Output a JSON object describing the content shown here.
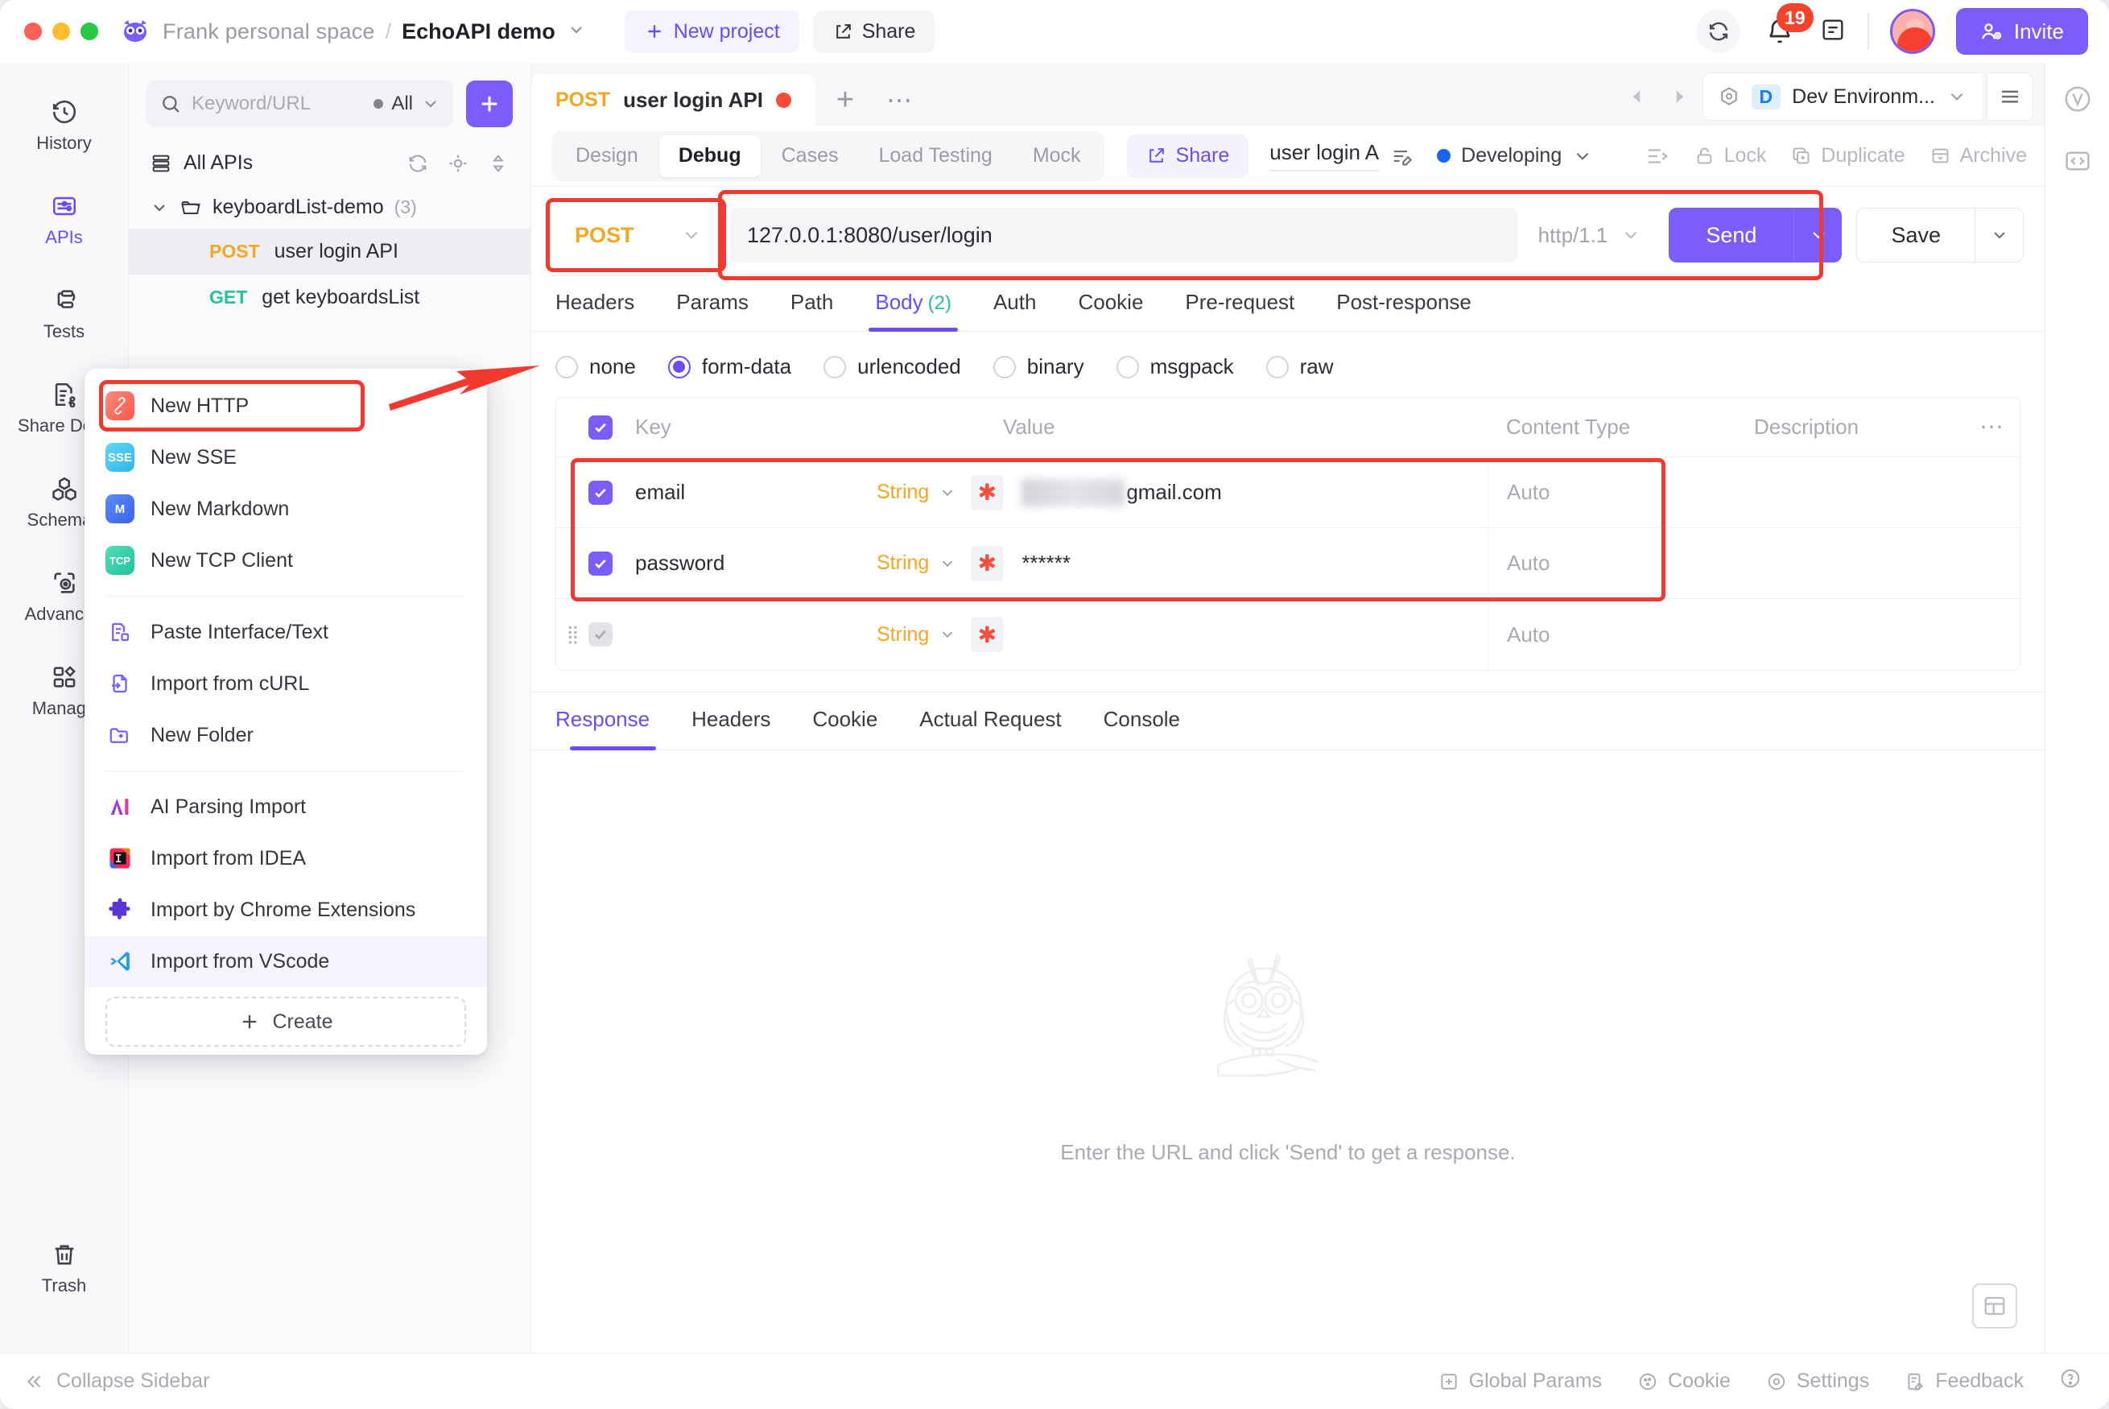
{
  "titlebar": {
    "workspace": "Frank personal space",
    "separator": "/",
    "project": "EchoAPI demo",
    "new_project": "New project",
    "share": "Share",
    "notification_count": "19",
    "invite": "Invite"
  },
  "rail": {
    "items": [
      {
        "label": "History",
        "icon": "history-icon",
        "active": false
      },
      {
        "label": "APIs",
        "icon": "apis-icon",
        "active": true
      },
      {
        "label": "Tests",
        "icon": "tests-icon",
        "active": false
      },
      {
        "label": "Share Docs",
        "icon": "share-docs-icon",
        "active": false
      },
      {
        "label": "Schemas",
        "icon": "schemas-icon",
        "active": false
      },
      {
        "label": "Advanced",
        "icon": "advanced-icon",
        "active": false
      },
      {
        "label": "Manage",
        "icon": "manage-icon",
        "active": false
      }
    ],
    "trash": "Trash"
  },
  "sidebar": {
    "search_placeholder": "Keyword/URL",
    "filter_label": "All",
    "all_apis": "All APIs",
    "folder": {
      "name": "keyboardList-demo",
      "count": "(3)"
    },
    "apis": [
      {
        "method": "POST",
        "name": "user login API",
        "selected": true
      },
      {
        "method": "GET",
        "name": "get keyboardsList",
        "selected": false
      }
    ]
  },
  "context_menu": {
    "group1": [
      {
        "label": "New HTTP",
        "icon": "http-icon",
        "highlighted": false
      },
      {
        "label": "New SSE",
        "icon": "sse-icon",
        "highlighted": false
      },
      {
        "label": "New Markdown",
        "icon": "markdown-icon",
        "highlighted": false
      },
      {
        "label": "New TCP Client",
        "icon": "tcp-icon",
        "highlighted": false
      }
    ],
    "group2": [
      {
        "label": "Paste Interface/Text",
        "icon": "paste-icon",
        "highlighted": false
      },
      {
        "label": "Import from cURL",
        "icon": "curl-import-icon",
        "highlighted": false
      },
      {
        "label": "New Folder",
        "icon": "new-folder-icon",
        "highlighted": false
      }
    ],
    "group3": [
      {
        "label": "AI Parsing Import",
        "icon": "ai-icon",
        "highlighted": false
      },
      {
        "label": "Import from IDEA",
        "icon": "idea-icon",
        "highlighted": false
      },
      {
        "label": "Import by Chrome Extensions",
        "icon": "chrome-extension-icon",
        "highlighted": false
      },
      {
        "label": "Import from VScode",
        "icon": "vscode-icon",
        "highlighted": true
      }
    ],
    "create": "Create"
  },
  "doc_tab": {
    "method": "POST",
    "title": "user login API",
    "env_badge": "D",
    "env_name": "Dev Environm..."
  },
  "subbar": {
    "segments": [
      {
        "label": "Design",
        "active": false
      },
      {
        "label": "Debug",
        "active": true
      },
      {
        "label": "Cases",
        "active": false
      },
      {
        "label": "Load Testing",
        "active": false
      },
      {
        "label": "Mock",
        "active": false
      }
    ],
    "share": "Share",
    "api_name": "user login A",
    "status": "Developing",
    "actions": [
      {
        "label": "Lock",
        "icon": "lock-icon"
      },
      {
        "label": "Duplicate",
        "icon": "duplicate-icon"
      },
      {
        "label": "Archive",
        "icon": "archive-icon"
      }
    ]
  },
  "request": {
    "method": "POST",
    "url": "127.0.0.1:8080/user/login",
    "protocol": "http/1.1",
    "send": "Send",
    "save": "Save",
    "tabs": [
      {
        "label": "Headers",
        "count": "",
        "active": false
      },
      {
        "label": "Params",
        "count": "",
        "active": false
      },
      {
        "label": "Path",
        "count": "",
        "active": false
      },
      {
        "label": "Body",
        "count": "(2)",
        "active": true
      },
      {
        "label": "Auth",
        "count": "",
        "active": false
      },
      {
        "label": "Cookie",
        "count": "",
        "active": false
      },
      {
        "label": "Pre-request",
        "count": "",
        "active": false
      },
      {
        "label": "Post-response",
        "count": "",
        "active": false
      }
    ],
    "body_types": [
      {
        "label": "none",
        "selected": false
      },
      {
        "label": "form-data",
        "selected": true
      },
      {
        "label": "urlencoded",
        "selected": false
      },
      {
        "label": "binary",
        "selected": false
      },
      {
        "label": "msgpack",
        "selected": false
      },
      {
        "label": "raw",
        "selected": false
      }
    ],
    "table": {
      "headers": [
        "Key",
        "Value",
        "Content Type",
        "Description"
      ],
      "rows": [
        {
          "checked": true,
          "key": "email",
          "type": "String",
          "required": "*",
          "value": "gmail.com",
          "value_masked": true,
          "content_type": "Auto",
          "description": ""
        },
        {
          "checked": true,
          "key": "password",
          "type": "String",
          "required": "*",
          "value": "******",
          "value_masked": false,
          "content_type": "Auto",
          "description": ""
        },
        {
          "checked": false,
          "key": "",
          "type": "String",
          "required": "*",
          "value": "",
          "value_masked": false,
          "content_type": "Auto",
          "description": ""
        }
      ]
    }
  },
  "response": {
    "tabs": [
      {
        "label": "Response",
        "active": true
      },
      {
        "label": "Headers",
        "active": false
      },
      {
        "label": "Cookie",
        "active": false
      },
      {
        "label": "Actual Request",
        "active": false
      },
      {
        "label": "Console",
        "active": false
      }
    ],
    "empty_message": "Enter the URL and click 'Send' to get a response."
  },
  "statusbar": {
    "collapse": "Collapse Sidebar",
    "items": [
      {
        "label": "Global Params",
        "icon": "global-params-icon"
      },
      {
        "label": "Cookie",
        "icon": "cookie-icon"
      },
      {
        "label": "Settings",
        "icon": "settings-icon"
      },
      {
        "label": "Feedback",
        "icon": "feedback-icon"
      }
    ]
  },
  "colors": {
    "accent": "#7c5cfa",
    "method_post": "#f5a623",
    "method_get": "#25c29a",
    "highlight_box": "#f03a2f"
  }
}
